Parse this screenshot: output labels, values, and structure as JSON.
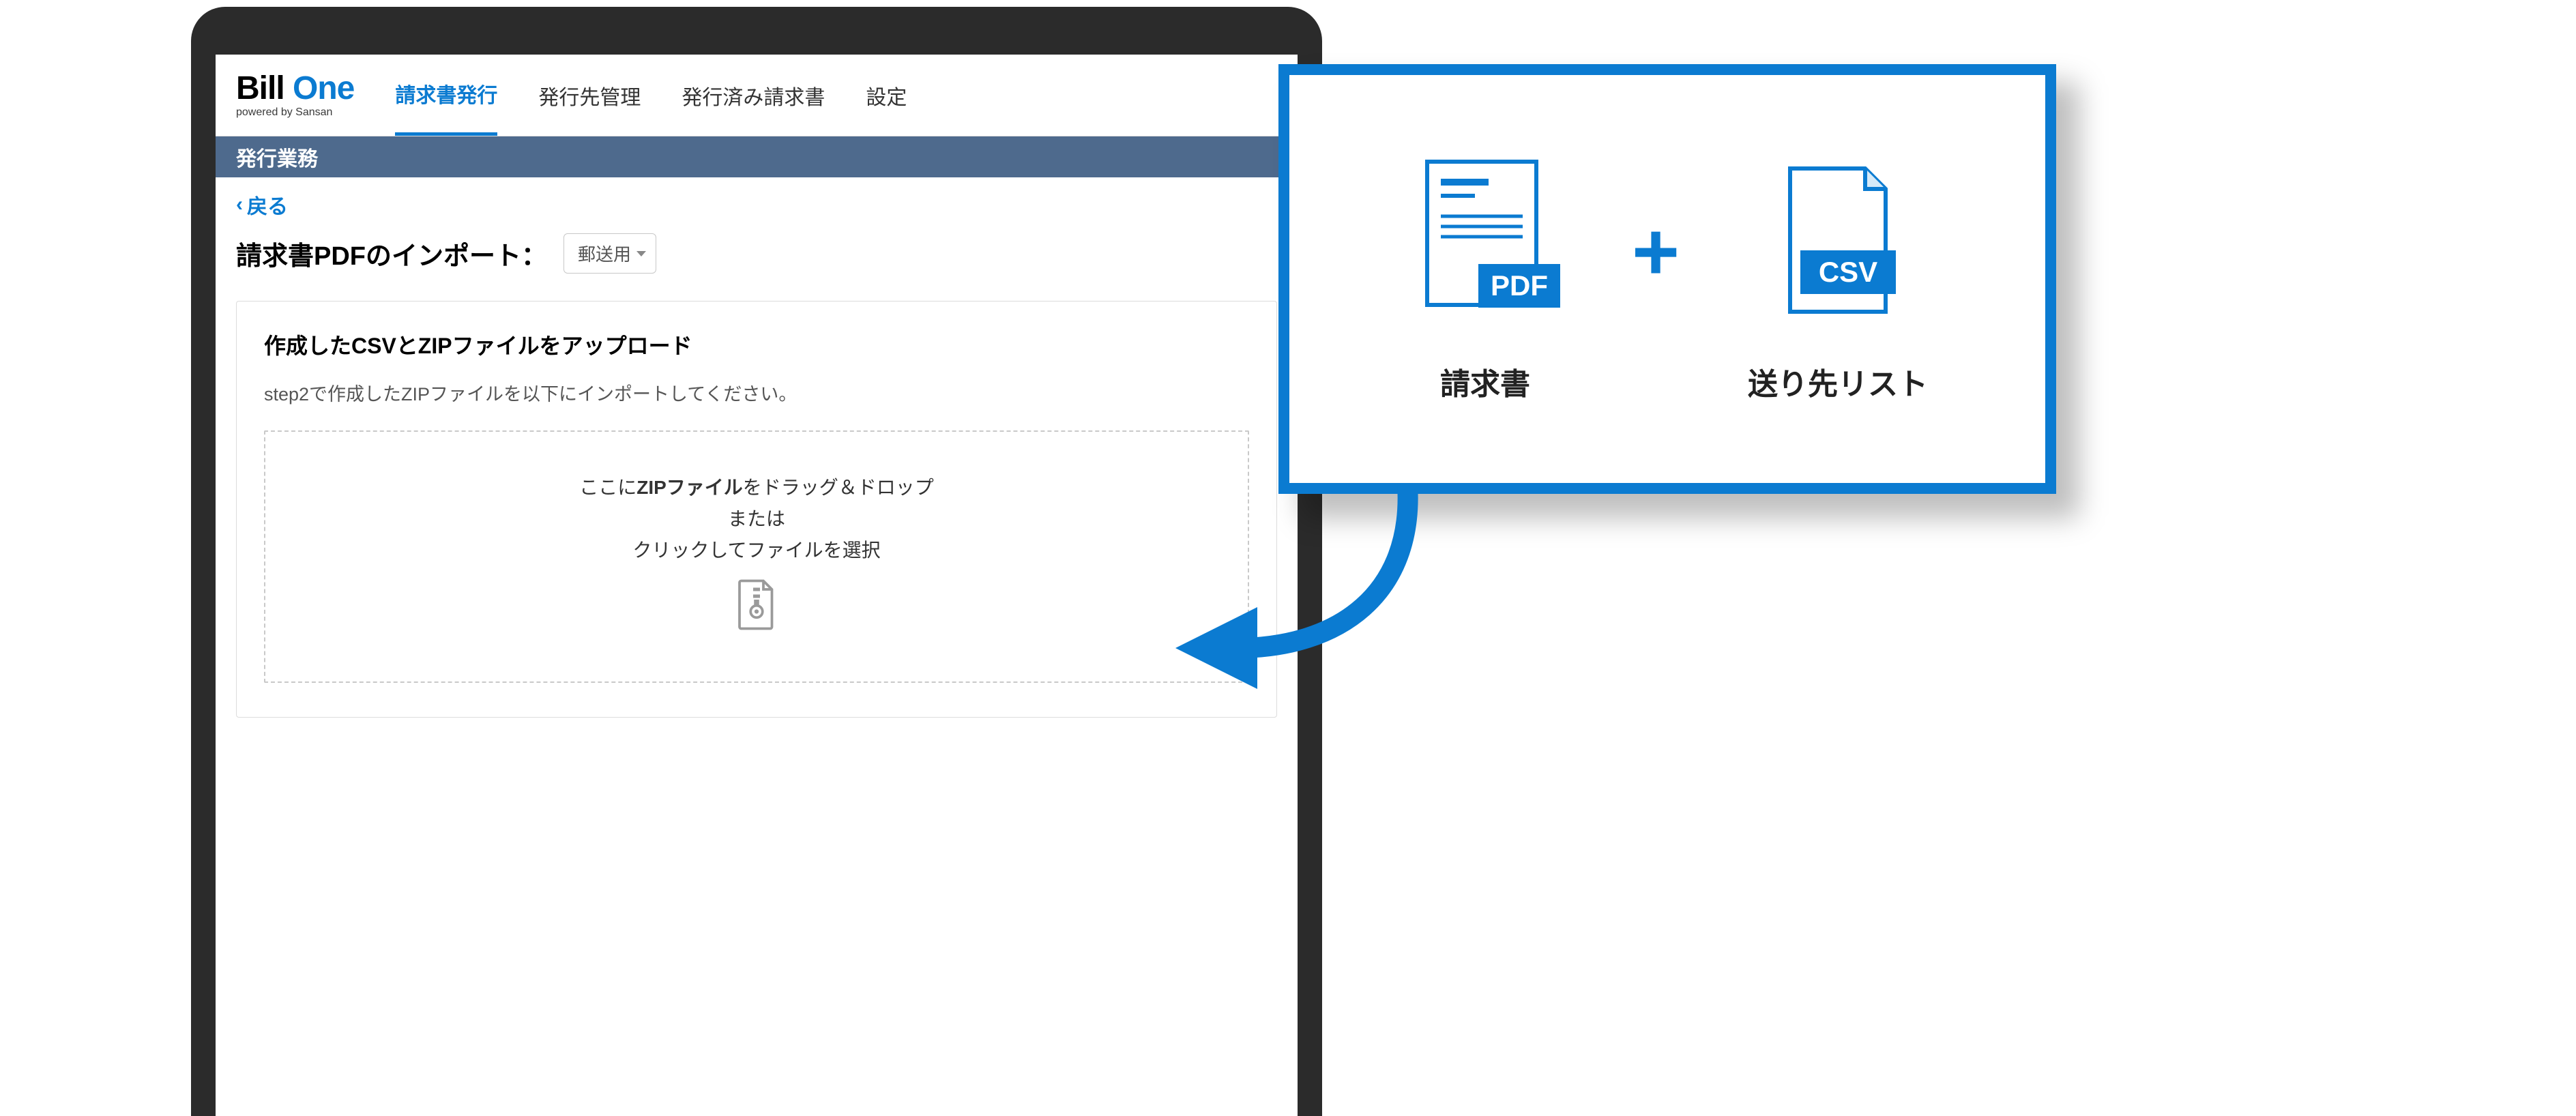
{
  "logo": {
    "main_a": "Bill",
    "main_b": "One",
    "sub": "powered by Sansan"
  },
  "nav": {
    "items": [
      {
        "label": "請求書発行",
        "active": true
      },
      {
        "label": "発行先管理",
        "active": false
      },
      {
        "label": "発行済み請求書",
        "active": false
      },
      {
        "label": "設定",
        "active": false
      }
    ]
  },
  "subbar": {
    "title": "発行業務"
  },
  "back": {
    "label": "戻る"
  },
  "page": {
    "title": "請求書PDFのインポート：",
    "dropdown_selected": "郵送用"
  },
  "upload": {
    "heading": "作成したCSVとZIPファイルをアップロード",
    "desc": "step2で作成したZIPファイルを以下にインポートしてください。",
    "dz_prefix": "ここに",
    "dz_bold": "ZIPファイル",
    "dz_suffix": "をドラッグ＆ドロップ",
    "dz_or": "または",
    "dz_click": "クリックしてファイルを選択"
  },
  "callout": {
    "left_icon_badge": "PDF",
    "left_label": "請求書",
    "plus": "+",
    "right_icon_badge": "CSV",
    "right_label": "送り先リスト"
  }
}
